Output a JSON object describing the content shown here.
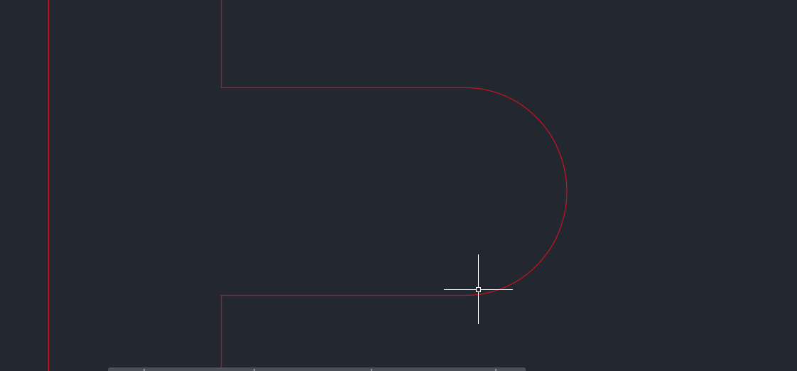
{
  "viewport": {
    "background_color": "#232730",
    "geometry_color": "#c8141e",
    "cursor_color": "#ffffff"
  },
  "command_bar": {
    "background_color": "#4a4f58"
  }
}
